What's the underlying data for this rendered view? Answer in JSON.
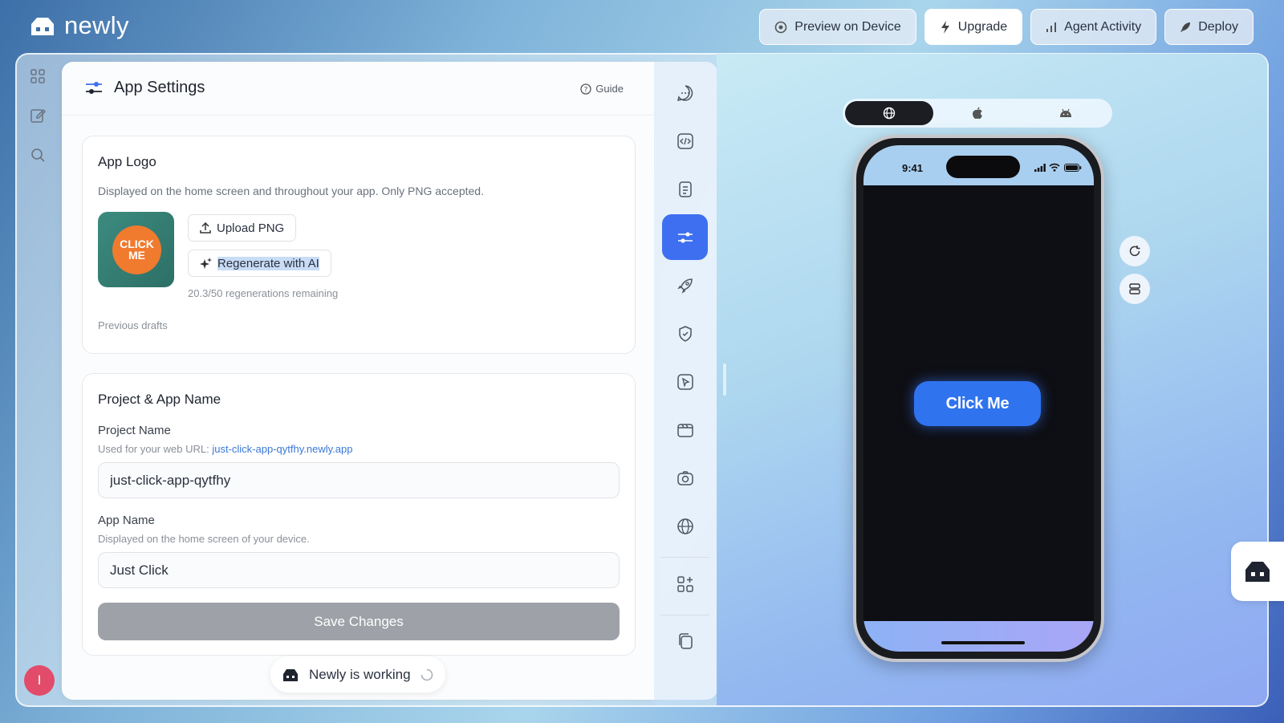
{
  "brand": {
    "name": "newly"
  },
  "topbar": {
    "preview_label": "Preview on Device",
    "upgrade_label": "Upgrade",
    "agent_label": "Agent Activity",
    "deploy_label": "Deploy"
  },
  "user": {
    "initial": "I"
  },
  "panel": {
    "title": "App Settings",
    "guide_label": "Guide",
    "logo": {
      "title": "App Logo",
      "description": "Displayed on the home screen and throughout your app. Only PNG accepted.",
      "image_text_1": "CLICK",
      "image_text_2": "ME",
      "upload_label": "Upload PNG",
      "regenerate_label": "Regenerate with AI",
      "remaining": "20.3/50 regenerations remaining",
      "previous_drafts": "Previous drafts"
    },
    "names": {
      "title": "Project & App Name",
      "project_label": "Project Name",
      "project_help": "Used for your web URL: ",
      "project_url": "just-click-app-qytfhy.newly.app",
      "project_value": "just-click-app-qytfhy",
      "app_label": "App Name",
      "app_help": "Displayed on the home screen of your device.",
      "app_value": "Just Click",
      "save_label": "Save Changes"
    }
  },
  "status": {
    "working_label": "Newly is working"
  },
  "phone": {
    "time": "9:41",
    "button_label": "Click Me"
  },
  "colors": {
    "accent": "#3d6ff0",
    "phone_button": "#2f73ef",
    "avatar": "#e34b6b",
    "logo_orange": "#f07a2e",
    "logo_green": "#3c8b80"
  }
}
